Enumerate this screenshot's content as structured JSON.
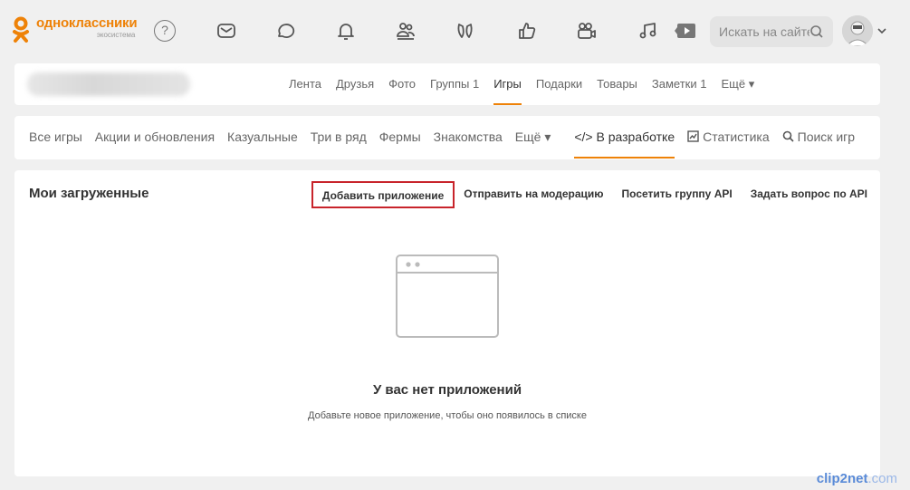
{
  "header": {
    "logo_name": "одноклассники",
    "logo_sub": "экосистема",
    "help_label": "?",
    "search_placeholder": "Искать на сайте",
    "nav_icons": [
      "mail-icon",
      "chat-icon",
      "bell-icon",
      "friends-icon",
      "guests-icon",
      "like-icon",
      "video-icon",
      "music-icon",
      "play-icon"
    ]
  },
  "profile_nav": {
    "tabs": [
      {
        "label": "Лента"
      },
      {
        "label": "Друзья"
      },
      {
        "label": "Фото"
      },
      {
        "label": "Группы 1"
      },
      {
        "label": "Игры",
        "active": true
      },
      {
        "label": "Подарки"
      },
      {
        "label": "Товары"
      },
      {
        "label": "Заметки 1"
      },
      {
        "label": "Ещё ▾"
      }
    ]
  },
  "games_nav": {
    "tabs": [
      {
        "label": "Все игры"
      },
      {
        "label": "Акции и обновления"
      },
      {
        "label": "Казуальные"
      },
      {
        "label": "Три в ряд"
      },
      {
        "label": "Фермы"
      },
      {
        "label": "Знакомства"
      },
      {
        "label": "Ещё ▾"
      },
      {
        "label": "</> В разработке",
        "active": true
      },
      {
        "label": "Статистика"
      },
      {
        "label": "Поиск игр"
      }
    ]
  },
  "main": {
    "title": "Мои загруженные",
    "actions": {
      "add_app": "Добавить приложение",
      "moderation": "Отправить на модерацию",
      "api_group": "Посетить группу API",
      "api_question": "Задать вопрос по API"
    },
    "empty_title": "У вас нет приложений",
    "empty_sub": "Добавьте новое приложение, чтобы оно появилось в списке"
  },
  "watermark": {
    "brand": "clip2net",
    "suffix": ".com"
  },
  "colors": {
    "accent": "#ee8208",
    "highlight": "#c8242b",
    "background": "#f0f0f0"
  }
}
